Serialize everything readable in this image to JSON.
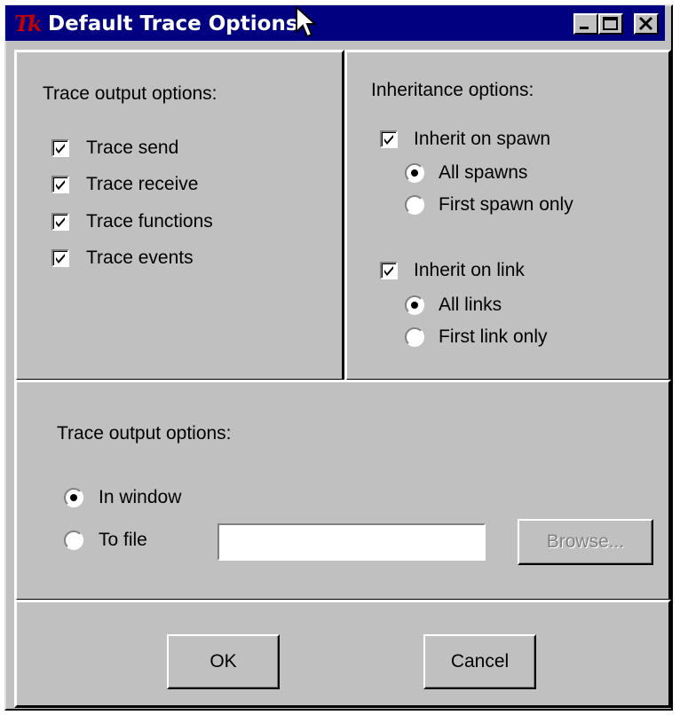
{
  "window": {
    "title": "Default Trace Options",
    "logo_text": "Tk"
  },
  "trace_panel": {
    "heading": "Trace output options:",
    "options": [
      {
        "label": "Trace send",
        "checked": true
      },
      {
        "label": "Trace receive",
        "checked": true
      },
      {
        "label": "Trace functions",
        "checked": true
      },
      {
        "label": "Trace events",
        "checked": true
      }
    ]
  },
  "inherit_panel": {
    "heading": "Inheritance options:",
    "spawn": {
      "label": "Inherit on spawn",
      "checked": true,
      "choices": [
        {
          "label": "All spawns",
          "selected": true
        },
        {
          "label": "First spawn only",
          "selected": false
        }
      ]
    },
    "link": {
      "label": "Inherit on link",
      "checked": true,
      "choices": [
        {
          "label": "All links",
          "selected": true
        },
        {
          "label": "First link only",
          "selected": false
        }
      ]
    }
  },
  "output_panel": {
    "heading": "Trace output options:",
    "choices": [
      {
        "label": "In window",
        "selected": true
      },
      {
        "label": "To file",
        "selected": false
      }
    ],
    "file_value": "",
    "browse_label": "Browse...",
    "browse_enabled": false
  },
  "footer": {
    "ok_label": "OK",
    "cancel_label": "Cancel"
  },
  "colors": {
    "titlebar": "#000080",
    "face": "#c0c0c0",
    "logo": "#c00000"
  }
}
